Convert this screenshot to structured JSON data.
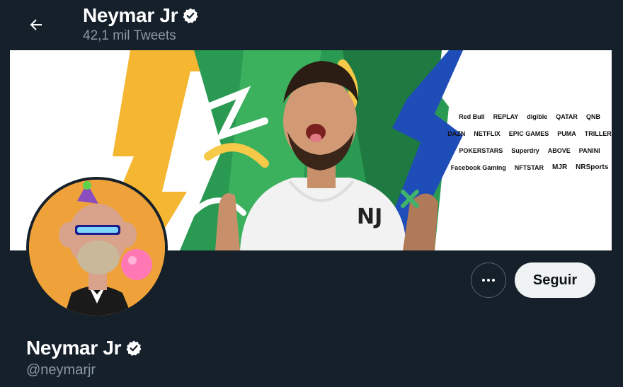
{
  "header": {
    "name": "Neymar Jr",
    "tweet_count": "42,1 mil Tweets",
    "back_icon": "arrow-left-icon",
    "verified_icon": "verified-badge-icon"
  },
  "banner": {
    "sponsors": [
      "Red Bull",
      "REPLAY",
      "digible",
      "QATAR",
      "QNB",
      "DAZN",
      "NETFLIX",
      "EPIC GAMES",
      "PUMA",
      "TRILLER",
      "POKERSTARS",
      "Superdry",
      "ABOVE",
      "PANINI",
      "Facebook Gaming",
      "NFTSTAR",
      "MJR",
      "NRSports"
    ],
    "shirt_logo": "NJ"
  },
  "profile": {
    "name": "Neymar Jr",
    "handle": "@neymarjr",
    "follow_label": "Seguir",
    "more_icon": "more-dots-icon"
  },
  "colors": {
    "background": "#15202b",
    "secondary_text": "#8b98a5",
    "button_bg": "#eff3f4"
  }
}
